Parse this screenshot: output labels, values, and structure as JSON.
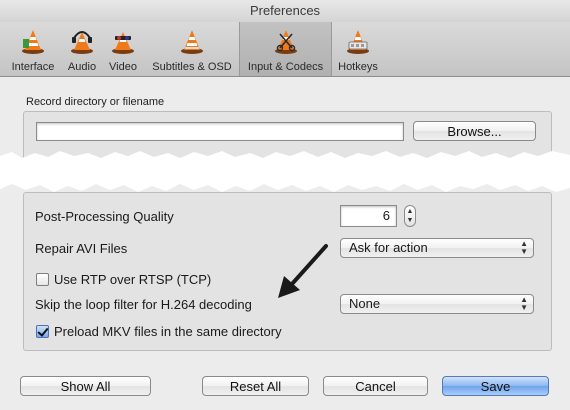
{
  "window": {
    "title": "Preferences"
  },
  "toolbar": {
    "tabs": [
      {
        "label": "Interface",
        "icon": "interface-cone-icon"
      },
      {
        "label": "Audio",
        "icon": "audio-cone-icon"
      },
      {
        "label": "Video",
        "icon": "video-cone-icon"
      },
      {
        "label": "Subtitles & OSD",
        "icon": "subtitles-cone-icon"
      },
      {
        "label": "Input & Codecs",
        "icon": "input-codecs-cone-icon",
        "selected": true
      },
      {
        "label": "Hotkeys",
        "icon": "hotkeys-cone-icon"
      }
    ]
  },
  "record": {
    "label": "Record directory or filename",
    "value": "",
    "browse_label": "Browse..."
  },
  "codecs": {
    "post_processing_label": "Post-Processing Quality",
    "post_processing_value": "6",
    "repair_avi_label": "Repair AVI Files",
    "repair_avi_value": "Ask for action",
    "rtp_label": "Use RTP over RTSP (TCP)",
    "rtp_checked": false,
    "skip_loop_label": "Skip the loop filter for H.264 decoding",
    "skip_loop_value": "None",
    "preload_mkv_label": "Preload MKV files in the same directory",
    "preload_mkv_checked": true
  },
  "footer": {
    "show_all": "Show All",
    "reset_all": "Reset All",
    "cancel": "Cancel",
    "save": "Save"
  },
  "colors": {
    "cone_orange": "#f07a1a",
    "primary_button": "#6fa3ea",
    "annotation_arrow": "#1a1a1a"
  }
}
